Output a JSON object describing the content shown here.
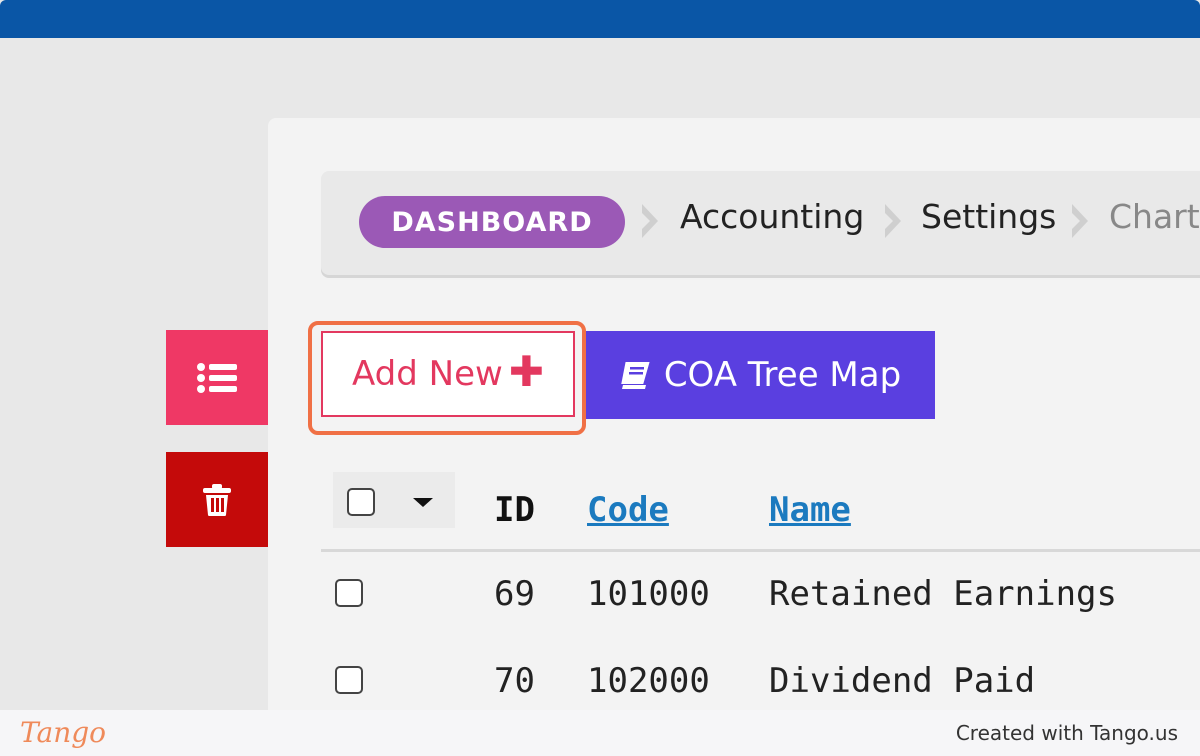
{
  "breadcrumb": {
    "dashboard": "DASHBOARD",
    "items": [
      "Accounting",
      "Settings",
      "Chart"
    ]
  },
  "toolbar": {
    "add_new_label": "Add New",
    "add_new_icon": "plus-icon",
    "coa_label": "COA Tree Map",
    "coa_icon": "book-icon"
  },
  "side_actions": {
    "list_icon": "list-icon",
    "delete_icon": "trash-icon"
  },
  "table": {
    "columns": [
      "ID",
      "Code",
      "Name"
    ],
    "rows": [
      {
        "id": "69",
        "code": "101000",
        "name": "Retained Earnings"
      },
      {
        "id": "70",
        "code": "102000",
        "name": "Dividend Paid"
      }
    ]
  },
  "footer": {
    "logo": "Tango",
    "created_with": "Created with Tango.us"
  },
  "colors": {
    "header_blue": "#0a56a6",
    "dashboard_purple": "#9b59b6",
    "add_new_pink": "#e3385f",
    "coa_purple": "#5a3fe0",
    "delete_red": "#c40a0a",
    "highlight_orange": "#f07045",
    "link_blue": "#1b7abf"
  }
}
